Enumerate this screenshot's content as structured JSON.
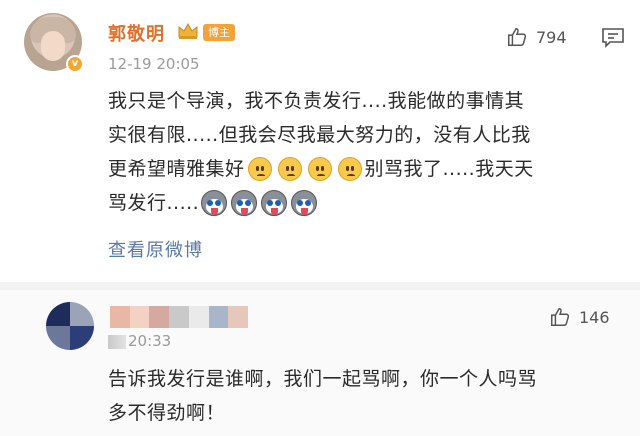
{
  "post": {
    "author_name": "郭敬明",
    "author_badge": "博主",
    "timestamp": "12-19 20:05",
    "likes": "794",
    "lines": [
      "我只是个导演，我不负责发行....我能做的事情其",
      "实很有限.....但我会尽我最大努力的，没有人比我",
      "更希望晴雅集好",
      "别骂我了.....我天天",
      "骂发行....."
    ],
    "view_original": "查看原微博",
    "icons": [
      "thumbs-up-icon",
      "comment-icon",
      "crown-icon",
      "verified-badge-icon",
      "sad-face-emoji",
      "husky-emoji"
    ],
    "accent_color": "#e0702a",
    "link_color": "#5b7aa8"
  },
  "comment": {
    "time_visible": "20:33",
    "likes": "146",
    "lines": [
      "告诉我发行是谁啊，我们一起骂啊，你一个人吗骂",
      "多不得劲啊！"
    ]
  }
}
